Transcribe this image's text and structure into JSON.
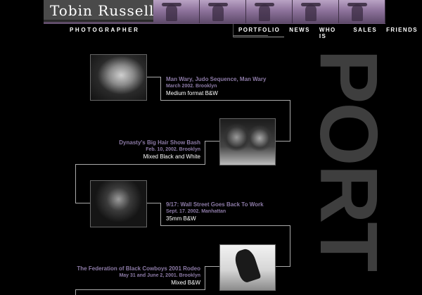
{
  "header": {
    "site_name": "Tobin Russell",
    "tagline": "PHOTOGRAPHER",
    "nav": [
      "PORTFOLIO",
      "NEWS",
      "WHO IS",
      "SALES",
      "FRIENDS"
    ]
  },
  "section_watermark": "PORT",
  "entries": [
    {
      "title": "Man Wary, Judo Sequence, Man Wary",
      "date": "March 2002. Brooklyn",
      "medium": "Medium format B&W"
    },
    {
      "title": "Dynasty's Big Hair Show Bash",
      "date": "Feb. 10, 2002. Brooklyn",
      "medium": "Mixed Black and White"
    },
    {
      "title": "9/17: Wall Street Goes Back To Work",
      "date": "Sept. 17. 2002. Manhattan",
      "medium": "35mm B&W"
    },
    {
      "title": "The Federation of Black Cowboys 2001 Rodeo",
      "date": "May 31 and June 2, 2001. Brooklyn",
      "medium": "Mixed B&W"
    }
  ],
  "colors": {
    "background": "#000000",
    "accent": "#8c7aa6",
    "header_strip": "#5d4a66",
    "watermark": "#3e3e3e"
  }
}
